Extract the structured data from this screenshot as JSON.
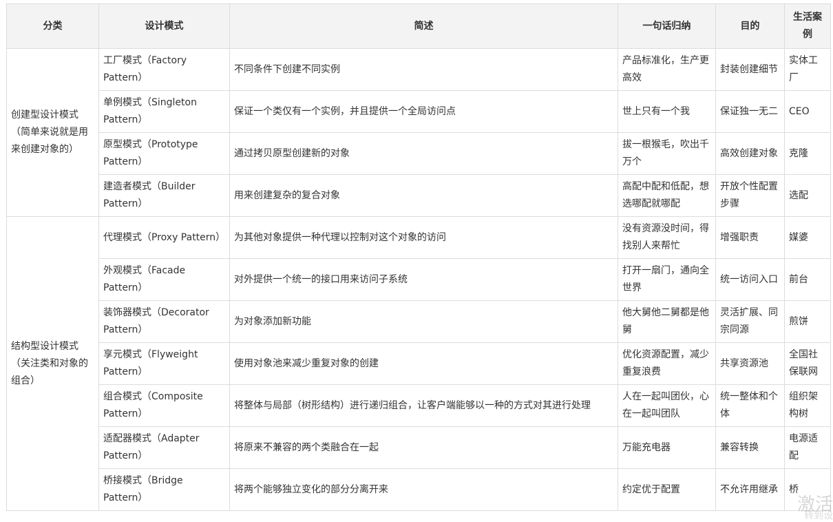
{
  "headers": [
    "分类",
    "设计模式",
    "简述",
    "一句话归纳",
    "目的",
    "生活案例"
  ],
  "categories": [
    {
      "label": "创建型设计模式（简单来说就是用来创建对象的）"
    },
    {
      "label": "结构型设计模式（关注类和对象的组合）"
    }
  ],
  "rows": [
    {
      "pattern": "工厂模式（Factory Pattern）",
      "desc": "不同条件下创建不同实例",
      "summary": "产品标准化，生产更高效",
      "purpose": "封装创建细节",
      "example": "实体工厂"
    },
    {
      "pattern": "单例模式（Singleton Pattern）",
      "desc": "保证一个类仅有一个实例，并且提供一个全局访问点",
      "summary": "世上只有一个我",
      "purpose": "保证独一无二",
      "example": "CEO"
    },
    {
      "pattern": "原型模式（Prototype Pattern）",
      "desc": "通过拷贝原型创建新的对象",
      "summary": "拔一根猴毛，吹出千万个",
      "purpose": "高效创建对象",
      "example": "克隆"
    },
    {
      "pattern": "建造者模式（Builder Pattern）",
      "desc": "用来创建复杂的复合对象",
      "summary": "高配中配和低配，想选哪配就哪配",
      "purpose": "开放个性配置步骤",
      "example": "选配"
    },
    {
      "pattern": "代理模式（Proxy Pattern）",
      "desc": "为其他对象提供一种代理以控制对这个对象的访问",
      "summary": "没有资源没时间，得找别人来帮忙",
      "purpose": "增强职责",
      "example": "媒婆"
    },
    {
      "pattern": "外观模式（Facade Pattern）",
      "desc": "对外提供一个统一的接口用来访问子系统",
      "summary": "打开一扇门，通向全世界",
      "purpose": "统一访问入口",
      "example": "前台"
    },
    {
      "pattern": "装饰器模式（Decorator Pattern）",
      "desc": "为对象添加新功能",
      "summary": "他大舅他二舅都是他舅",
      "purpose": "灵活扩展、同宗同源",
      "example": "煎饼"
    },
    {
      "pattern": "享元模式（Flyweight Pattern）",
      "desc": "使用对象池来减少重复对象的创建",
      "summary": "优化资源配置，减少重复浪费",
      "purpose": "共享资源池",
      "example": "全国社保联网"
    },
    {
      "pattern": "组合模式（Composite Pattern）",
      "desc": "将整体与局部（树形结构）进行递归组合，让客户端能够以一种的方式对其进行处理",
      "summary": "人在一起叫团伙，心在一起叫团队",
      "purpose": "统一整体和个体",
      "example": "组织架构树"
    },
    {
      "pattern": "适配器模式（Adapter Pattern）",
      "desc": "将原来不兼容的两个类融合在一起",
      "summary": "万能充电器",
      "purpose": "兼容转换",
      "example": "电源适配"
    },
    {
      "pattern": "桥接模式（Bridge Pattern）",
      "desc": "将两个能够独立变化的部分分离开来",
      "summary": "约定优于配置",
      "purpose": "不允许用继承",
      "example": "桥"
    }
  ],
  "watermark": {
    "main": "激活",
    "sub": "转到设"
  }
}
